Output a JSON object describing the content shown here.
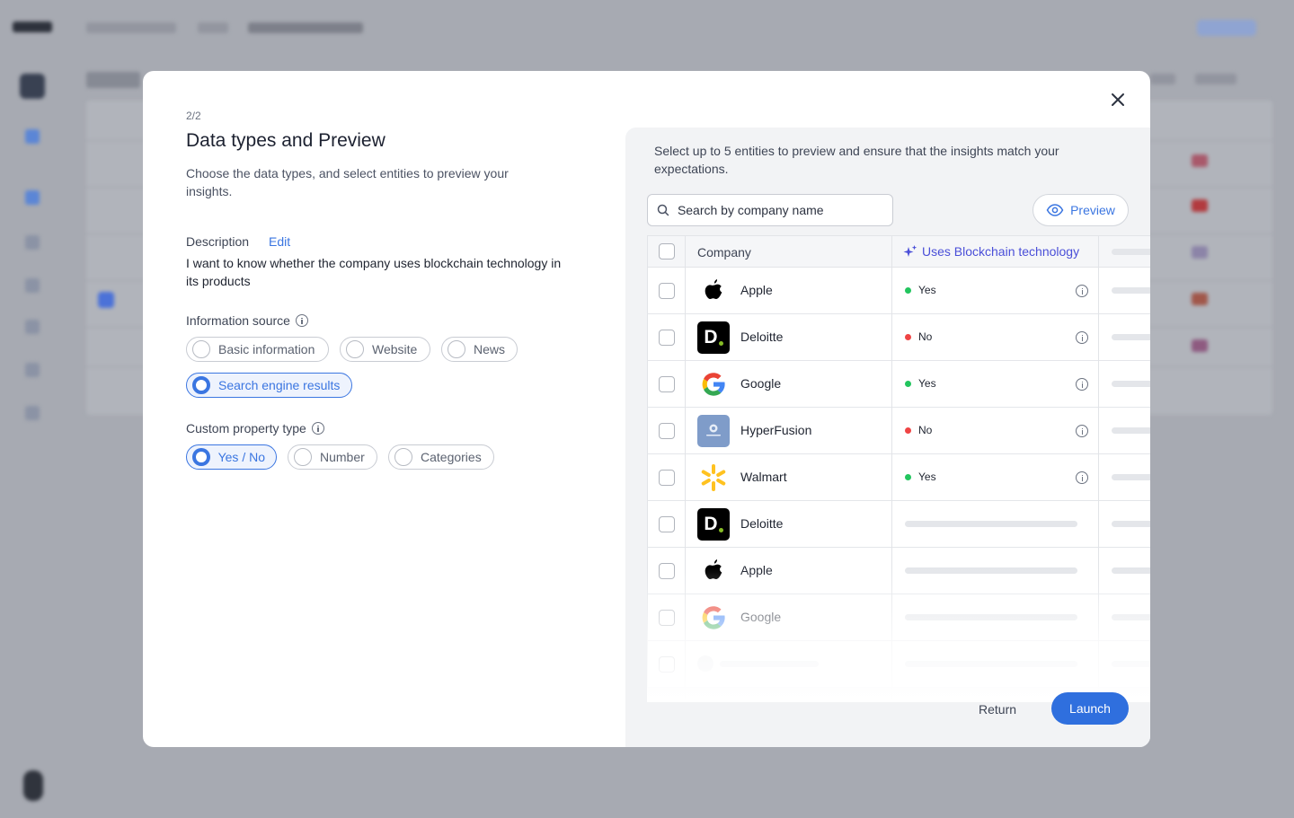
{
  "modal": {
    "step": "2/2",
    "title": "Data types and Preview",
    "subtitle": "Choose the data types, and select entities to preview your insights.",
    "description": {
      "label": "Description",
      "edit_label": "Edit",
      "text": "I want to know whether the company uses blockchain technology in its products"
    },
    "information_source": {
      "label": "Information source",
      "options": [
        {
          "label": "Basic information",
          "selected": false
        },
        {
          "label": "Website",
          "selected": false
        },
        {
          "label": "News",
          "selected": false
        },
        {
          "label": "Search engine results",
          "selected": true
        }
      ]
    },
    "custom_property_type": {
      "label": "Custom property type",
      "options": [
        {
          "label": "Yes / No",
          "selected": true
        },
        {
          "label": "Number",
          "selected": false
        },
        {
          "label": "Categories",
          "selected": false
        }
      ]
    },
    "footer": {
      "return_label": "Return",
      "launch_label": "Launch"
    }
  },
  "preview_panel": {
    "intro": "Select up to 5 entities to preview and ensure that the insights match your expectations.",
    "search_placeholder": "Search by company name",
    "preview_label": "Preview",
    "table": {
      "col_company": "Company",
      "col_insight": "Uses Blockchain technology",
      "rows": [
        {
          "company": "Apple",
          "logo": "apple-logo",
          "result": "Yes"
        },
        {
          "company": "Deloitte",
          "logo": "deloitte-logo",
          "result": "No"
        },
        {
          "company": "Google",
          "logo": "google-logo",
          "result": "Yes"
        },
        {
          "company": "HyperFusion",
          "logo": "hyperfusion-logo",
          "result": "No"
        },
        {
          "company": "Walmart",
          "logo": "walmart-logo",
          "result": "Yes"
        },
        {
          "company": "Deloitte",
          "logo": "deloitte-logo",
          "result": ""
        },
        {
          "company": "Apple",
          "logo": "apple-logo",
          "result": ""
        },
        {
          "company": "Google",
          "logo": "google-logo",
          "result": ""
        }
      ]
    }
  },
  "colors": {
    "accent": "#3b76e1",
    "ai_purple": "#4a4fd8",
    "yes_dot": "#22c55e",
    "no_dot": "#ef4444"
  }
}
